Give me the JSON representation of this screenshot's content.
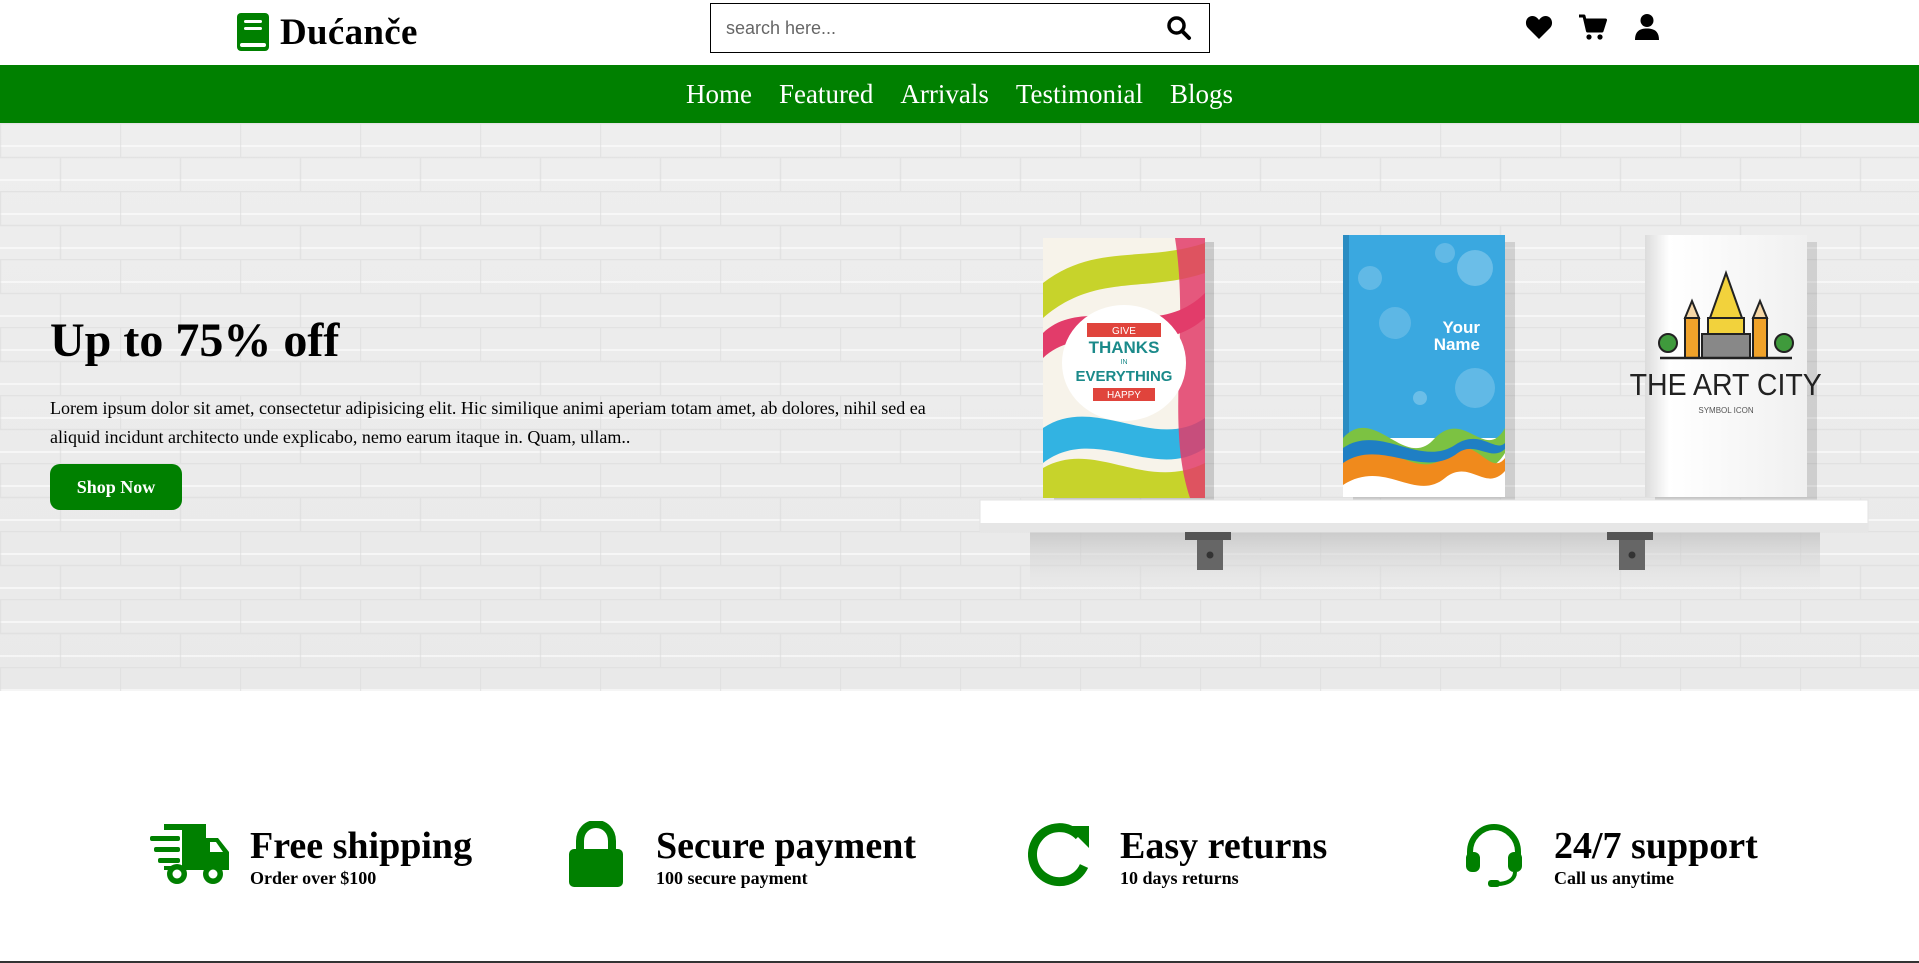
{
  "brand": {
    "name": "Dućanče",
    "icon": "book-icon",
    "color": "#008000"
  },
  "search": {
    "placeholder": "search here...",
    "value": "",
    "icon": "search-icon"
  },
  "header_icons": [
    {
      "name": "heart-icon"
    },
    {
      "name": "cart-icon"
    },
    {
      "name": "user-icon"
    }
  ],
  "nav": {
    "background": "#008000",
    "items": [
      {
        "label": "Home"
      },
      {
        "label": "Featured"
      },
      {
        "label": "Arrivals"
      },
      {
        "label": "Testimonial"
      },
      {
        "label": "Blogs"
      }
    ]
  },
  "hero": {
    "title": "Up to 75% off",
    "text": "Lorem ipsum dolor sit amet, consectetur adipisicing elit. Hic similique animi aperiam totam amet, ab dolores, nihil sed ea aliquid incidunt architecto unde explicabo, nemo earum itaque in. Quam, ullam..",
    "button_label": "Shop Now",
    "books": [
      {
        "lines": [
          "GIVE",
          "THANKS",
          "IN",
          "EVERYTHING",
          "HAPPY"
        ]
      },
      {
        "lines": [
          "Your",
          "Name"
        ]
      },
      {
        "lines": [
          "THE ART CITY",
          "SYMBOL ICON"
        ]
      }
    ]
  },
  "features": [
    {
      "icon": "truck-icon",
      "title": "Free shipping",
      "subtitle": "Order over $100"
    },
    {
      "icon": "lock-icon",
      "title": "Secure payment",
      "subtitle": "100 secure payment"
    },
    {
      "icon": "redo-icon",
      "title": "Easy returns",
      "subtitle": "10 days returns"
    },
    {
      "icon": "headset-icon",
      "title": "24/7 support",
      "subtitle": "Call us anytime"
    }
  ]
}
